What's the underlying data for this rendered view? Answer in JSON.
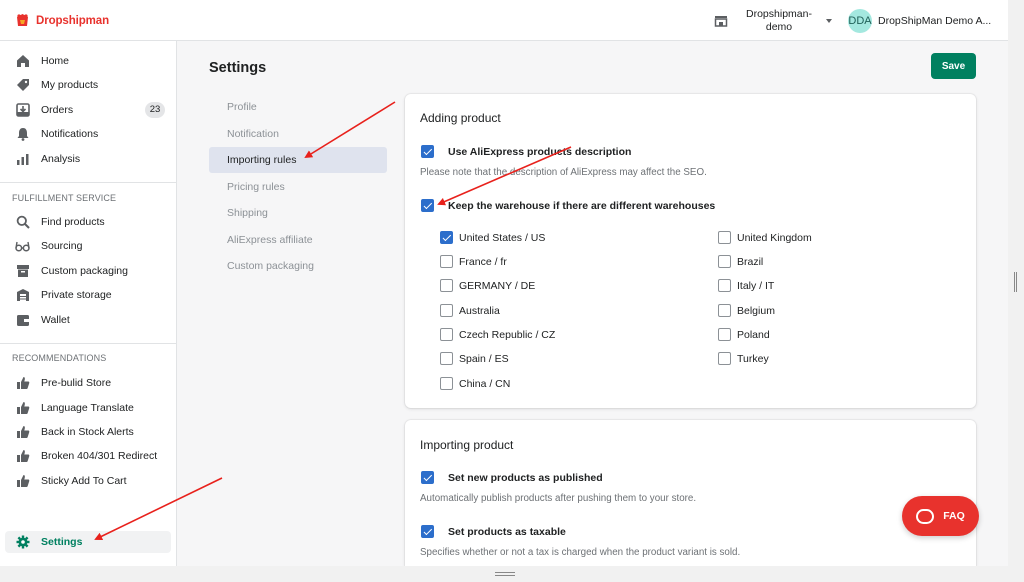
{
  "brand": {
    "name": "Dropshipman",
    "color": "#e8322d"
  },
  "topbar": {
    "store_line1": "Dropshipman-",
    "store_line2": "demo",
    "user_initials": "DDA",
    "user_name": "DropShipMan Demo A..."
  },
  "sidebar": {
    "main": [
      {
        "label": "Home",
        "icon": "home-icon"
      },
      {
        "label": "My products",
        "icon": "tag-icon"
      },
      {
        "label": "Orders",
        "icon": "orders-icon",
        "badge": "23"
      },
      {
        "label": "Notifications",
        "icon": "bell-icon"
      },
      {
        "label": "Analysis",
        "icon": "chart-icon"
      }
    ],
    "fulfillment_title": "FULFILLMENT SERVICE",
    "fulfillment": [
      {
        "label": "Find products",
        "icon": "search-icon"
      },
      {
        "label": "Sourcing",
        "icon": "glasses-icon"
      },
      {
        "label": "Custom packaging",
        "icon": "package-icon"
      },
      {
        "label": "Private storage",
        "icon": "warehouse-icon"
      },
      {
        "label": "Wallet",
        "icon": "wallet-icon"
      }
    ],
    "recommendations_title": "RECOMMENDATIONS",
    "recommendations": [
      {
        "label": "Pre-bulid Store",
        "icon": "thumbs-up-icon"
      },
      {
        "label": "Language Translate",
        "icon": "thumbs-up-icon"
      },
      {
        "label": "Back in Stock Alerts",
        "icon": "thumbs-up-icon"
      },
      {
        "label": "Broken 404/301 Redirect",
        "icon": "thumbs-up-icon"
      },
      {
        "label": "Sticky Add To Cart",
        "icon": "thumbs-up-icon"
      }
    ],
    "settings_label": "Settings"
  },
  "page": {
    "title": "Settings",
    "save_label": "Save"
  },
  "subnav": [
    "Profile",
    "Notification",
    "Importing rules",
    "Pricing rules",
    "Shipping",
    "AliExpress affiliate",
    "Custom packaging"
  ],
  "adding_card": {
    "title": "Adding product",
    "use_desc_label": "Use AliExpress products description",
    "use_desc_help": "Please note that the description of AliExpress may affect the SEO.",
    "keep_wh_label": "Keep the warehouse if there are different warehouses",
    "warehouses_left": [
      {
        "label": "United States / US",
        "checked": true
      },
      {
        "label": "France / fr",
        "checked": false
      },
      {
        "label": "GERMANY / DE",
        "checked": false
      },
      {
        "label": "Australia",
        "checked": false
      },
      {
        "label": "Czech Republic / CZ",
        "checked": false
      },
      {
        "label": "Spain / ES",
        "checked": false
      },
      {
        "label": "China / CN",
        "checked": false
      }
    ],
    "warehouses_right": [
      {
        "label": "United Kingdom",
        "checked": false
      },
      {
        "label": "Brazil",
        "checked": false
      },
      {
        "label": "Italy / IT",
        "checked": false
      },
      {
        "label": "Belgium",
        "checked": false
      },
      {
        "label": "Poland",
        "checked": false
      },
      {
        "label": "Turkey",
        "checked": false
      }
    ]
  },
  "importing_card": {
    "title": "Importing product",
    "published_label": "Set new products as published",
    "published_help": "Automatically publish products after pushing them to your store.",
    "taxable_label": "Set products as taxable",
    "taxable_help": "Specifies whether or not a tax is charged when the product variant is sold."
  },
  "faq_label": "FAQ",
  "colors": {
    "primary": "#008060",
    "checkbox": "#2c6ecb",
    "annotation": "#e8211c"
  }
}
